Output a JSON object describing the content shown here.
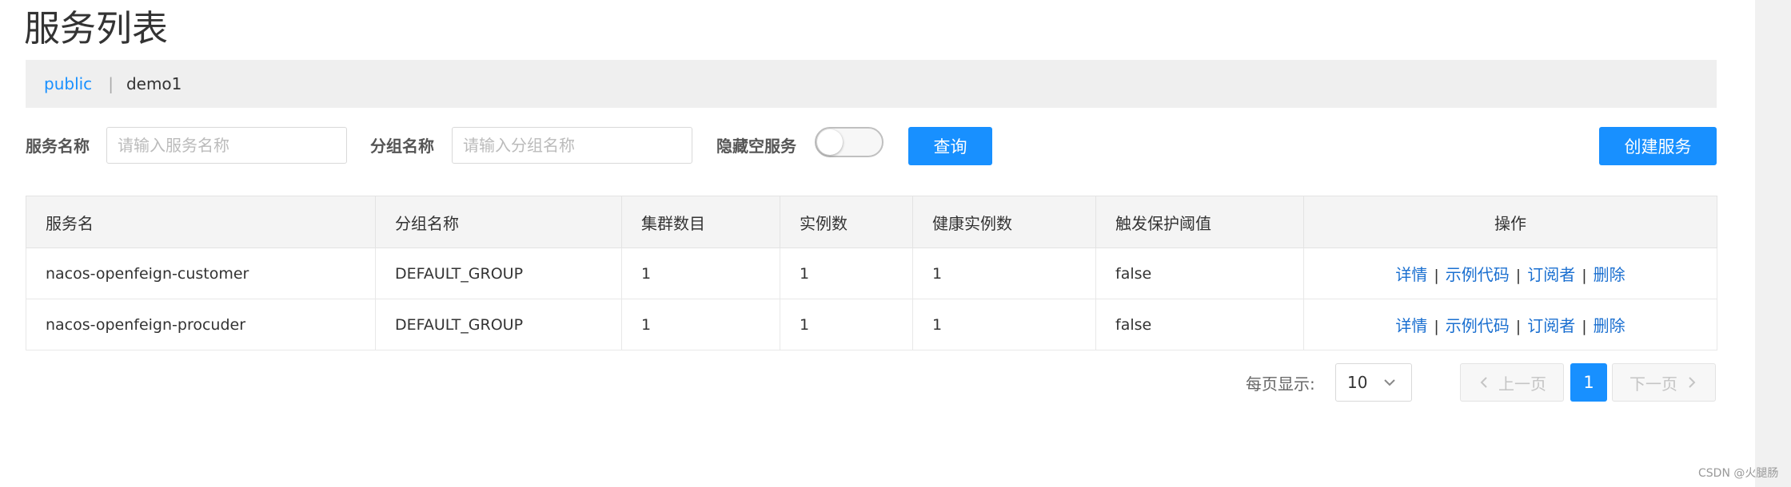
{
  "page": {
    "title": "服务列表"
  },
  "namespace": {
    "link": "public",
    "separator": "|",
    "current": "demo1"
  },
  "filters": {
    "service_name_label": "服务名称",
    "service_name_placeholder": "请输入服务名称",
    "group_name_label": "分组名称",
    "group_name_placeholder": "请输入分组名称",
    "hide_empty_label": "隐藏空服务",
    "hide_empty_checked": false,
    "query_button": "查询",
    "create_button": "创建服务"
  },
  "table": {
    "columns": [
      "服务名",
      "分组名称",
      "集群数目",
      "实例数",
      "健康实例数",
      "触发保护阈值",
      "操作"
    ],
    "rows": [
      {
        "name": "nacos-openfeign-customer",
        "group": "DEFAULT_GROUP",
        "clusters": "1",
        "instances": "1",
        "healthy": "1",
        "threshold": "false"
      },
      {
        "name": "nacos-openfeign-procuder",
        "group": "DEFAULT_GROUP",
        "clusters": "1",
        "instances": "1",
        "healthy": "1",
        "threshold": "false"
      }
    ],
    "actions": {
      "detail": "详情",
      "sample_code": "示例代码",
      "subscribers": "订阅者",
      "delete": "删除",
      "sep": "|"
    }
  },
  "pagination": {
    "page_size_label": "每页显示:",
    "page_size": "10",
    "prev": "上一页",
    "current_page": "1",
    "next": "下一页"
  },
  "watermark": "CSDN @火腿肠",
  "colors": {
    "accent": "#1890ff",
    "link": "#1a6fd0"
  }
}
